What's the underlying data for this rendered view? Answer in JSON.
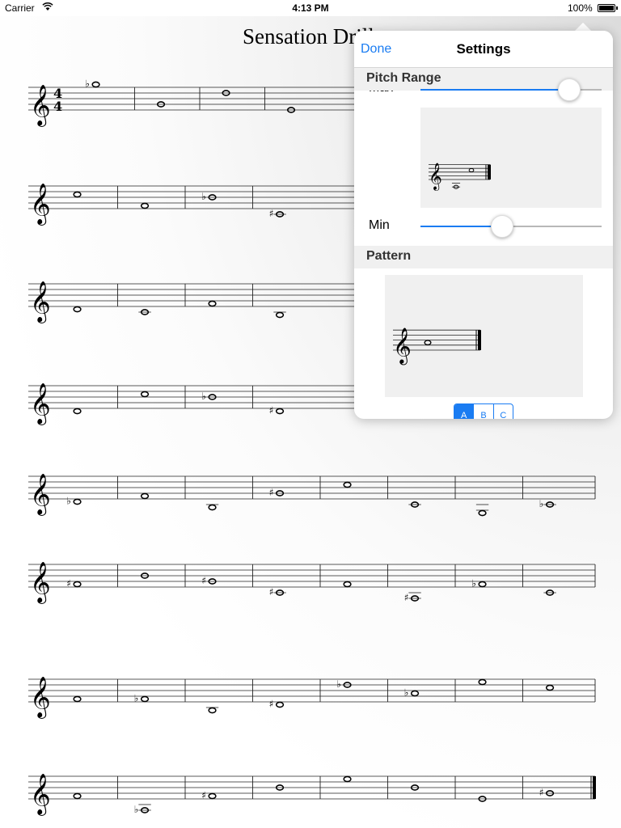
{
  "status_bar": {
    "carrier": "Carrier",
    "time": "4:13 PM",
    "battery": "100%"
  },
  "sheet": {
    "title": "Sensation Drill"
  },
  "settings": {
    "done_label": "Done",
    "title": "Settings",
    "pitch_range": {
      "header": "Pitch Range",
      "max_label": "Max",
      "min_label": "Min",
      "max_value": 0.82,
      "min_value": 0.45
    },
    "pattern": {
      "header": "Pattern",
      "options": [
        "A",
        "B",
        "C"
      ],
      "selected": "A"
    }
  },
  "colors": {
    "accent": "#1a7cf2"
  },
  "score": {
    "time_signature": "4/4",
    "systems": [
      {
        "notes": [
          {
            "s": 9,
            "acc": "flat"
          },
          {
            "s": 2
          },
          {
            "s": 6
          },
          {
            "s": 0
          }
        ]
      },
      {
        "notes": [
          {
            "s": 5
          },
          {
            "s": 1
          },
          {
            "s": 4,
            "acc": "flat"
          },
          {
            "s": -2,
            "acc": "sharp"
          }
        ]
      },
      {
        "notes": [
          {
            "s": -1
          },
          {
            "s": -2
          },
          {
            "s": 1
          },
          {
            "s": -3
          }
        ]
      },
      {
        "notes": [
          {
            "s": -1
          },
          {
            "s": 5
          },
          {
            "s": 4,
            "acc": "flat"
          },
          {
            "s": -1,
            "acc": "sharp"
          }
        ]
      },
      {
        "notes": [
          {
            "s": -1,
            "acc": "flat"
          },
          {
            "s": 1
          },
          {
            "s": -3
          },
          {
            "s": 2,
            "acc": "sharp"
          },
          {
            "s": 5
          },
          {
            "s": -2
          },
          {
            "s": -5
          },
          {
            "s": -2,
            "acc": "flat"
          }
        ]
      },
      {
        "notes": [
          {
            "s": 1,
            "acc": "sharp"
          },
          {
            "s": 4
          },
          {
            "s": 2,
            "acc": "sharp"
          },
          {
            "s": -2,
            "acc": "sharp"
          },
          {
            "s": 1
          },
          {
            "s": -4,
            "acc": "sharp"
          },
          {
            "s": 1,
            "acc": "flat"
          },
          {
            "s": -2
          }
        ]
      },
      {
        "notes": [
          {
            "s": 1
          },
          {
            "s": 1,
            "acc": "flat"
          },
          {
            "s": -3
          },
          {
            "s": -1,
            "acc": "sharp"
          },
          {
            "s": 6,
            "acc": "flat"
          },
          {
            "s": 3,
            "acc": "flat"
          },
          {
            "s": 7
          },
          {
            "s": 5
          }
        ]
      },
      {
        "notes": [
          {
            "s": 1
          },
          {
            "s": -4,
            "acc": "flat"
          },
          {
            "s": 1,
            "acc": "sharp"
          },
          {
            "s": 4
          },
          {
            "s": 7
          },
          {
            "s": 4
          },
          {
            "s": 0
          },
          {
            "s": 2,
            "acc": "sharp"
          }
        ],
        "final": true
      }
    ],
    "pitch_preview": {
      "notes": [
        {
          "s": -4
        },
        {
          "s": 5
        }
      ]
    },
    "pattern_preview": {
      "notes": [
        {
          "s": 3
        }
      ]
    }
  }
}
